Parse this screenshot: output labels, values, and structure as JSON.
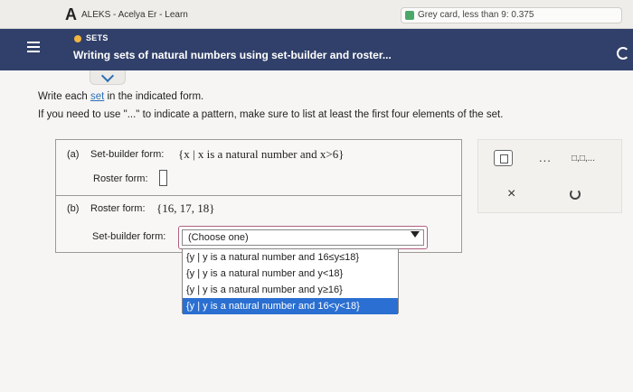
{
  "browser": {
    "brand_letter": "A",
    "tab_title": "ALEKS - Acelya Er - Learn",
    "extension_text": "Grey card, less than 9: 0.375"
  },
  "header": {
    "section": "SETS",
    "title": "Writing sets of natural numbers using set-builder and roster..."
  },
  "instructions": {
    "line1_pre": "Write each ",
    "line1_link": "set",
    "line1_post": " in the indicated form.",
    "line2": "If you need to use \"...\" to indicate a pattern, make sure to list at least the first four elements of the set."
  },
  "part_a": {
    "label": "(a)",
    "setbuilder_label": "Set-builder form:",
    "setbuilder_math": "{x | x is a natural number and x>6}",
    "roster_label": "Roster form:",
    "roster_value": ""
  },
  "part_b": {
    "label": "(b)",
    "roster_label": "Roster form:",
    "roster_math": "{16, 17, 18}",
    "setbuilder_label": "Set-builder form:",
    "select_value": "(Choose one)",
    "options": [
      "{y | y is a natural number and 16≤y≤18}",
      "{y | y is a natural number and y<18}",
      "{y | y is a natural number and y≥16}",
      "{y | y is a natural number and 16<y<18}"
    ],
    "selected_index": 3
  },
  "tools": {
    "dots": "...",
    "subscript": "□,□,..."
  }
}
